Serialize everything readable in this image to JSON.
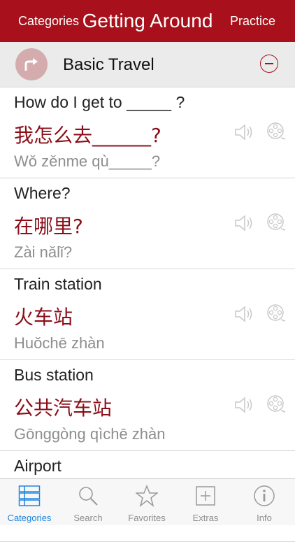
{
  "navbar": {
    "back_label": "Categories",
    "title": "Getting Around",
    "action_label": "Practice"
  },
  "section": {
    "title": "Basic Travel",
    "icon": "turn-right-arrow-icon",
    "collapse_icon": "minus-circle-icon"
  },
  "phrases": [
    {
      "english": "How do I get to _____ ?",
      "chinese": "我怎么去______?",
      "pinyin": "Wǒ zěnme qù_____?"
    },
    {
      "english": "Where?",
      "chinese": "在哪里?",
      "pinyin": "Zài nǎlǐ?"
    },
    {
      "english": "Train station",
      "chinese": "火车站",
      "pinyin": "Huǒchē zhàn"
    },
    {
      "english": "Bus station",
      "chinese": "公共汽车站",
      "pinyin": "Gōnggòng qìchē zhàn"
    },
    {
      "english": "Airport",
      "chinese": "",
      "pinyin": ""
    }
  ],
  "tabbar": {
    "items": [
      {
        "label": "Categories",
        "icon": "list-icon",
        "active": true
      },
      {
        "label": "Search",
        "icon": "search-icon",
        "active": false
      },
      {
        "label": "Favorites",
        "icon": "star-icon",
        "active": false
      },
      {
        "label": "Extras",
        "icon": "plus-box-icon",
        "active": false
      },
      {
        "label": "Info",
        "icon": "info-icon",
        "active": false
      }
    ]
  },
  "colors": {
    "brand": "#a8111b",
    "chinese_text": "#8b0e18",
    "tab_active": "#1f86e0"
  }
}
